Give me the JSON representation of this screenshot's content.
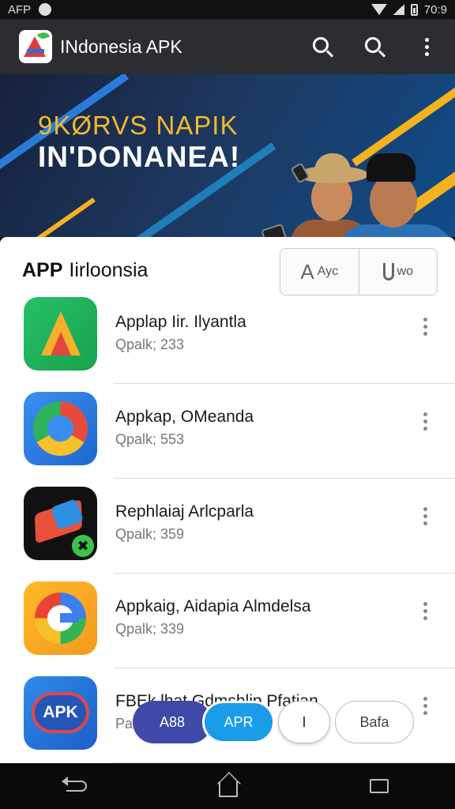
{
  "status_bar": {
    "carrier": "AFP",
    "time": "70:9"
  },
  "app_bar": {
    "title": "INdonesia APK"
  },
  "hero": {
    "subtitle": "9KØRVS NAPIK",
    "headline": "IN'DONANEA!"
  },
  "section": {
    "title_bold": "APP",
    "title_rest": "Iirloonsia",
    "toggle": [
      {
        "label": "Ayc"
      },
      {
        "label": "wo"
      }
    ]
  },
  "apps": [
    {
      "name": "Applap Iir. Ilyantla",
      "meta": "Qpalk; 233"
    },
    {
      "name": "Appkap, OMeanda",
      "meta": "Qpalk; 553"
    },
    {
      "name": "Rephlaiaj Arlcparla",
      "meta": "Qpalk; 359",
      "badge": "✖"
    },
    {
      "name": "Appkaig, Aidapia Almdelsa",
      "meta": "Qpalk; 339"
    },
    {
      "name": "FBEk lhat Gdmshlip Pfatian",
      "meta": "Pa",
      "icon_text": "APK"
    }
  ],
  "bottom_chips": [
    "A88",
    "APR",
    "I",
    "Bafa"
  ],
  "colors": {
    "app_bar": "#2b2d31",
    "accent_blue": "#1a9ce8",
    "accent_indigo": "#3f4aa8",
    "hero_yellow": "#f4b82a"
  },
  "icons": {
    "app_bar": [
      "search-icon",
      "search-icon",
      "more-vert-icon"
    ],
    "nav": [
      "back-icon",
      "home-icon",
      "recent-apps-icon"
    ]
  }
}
